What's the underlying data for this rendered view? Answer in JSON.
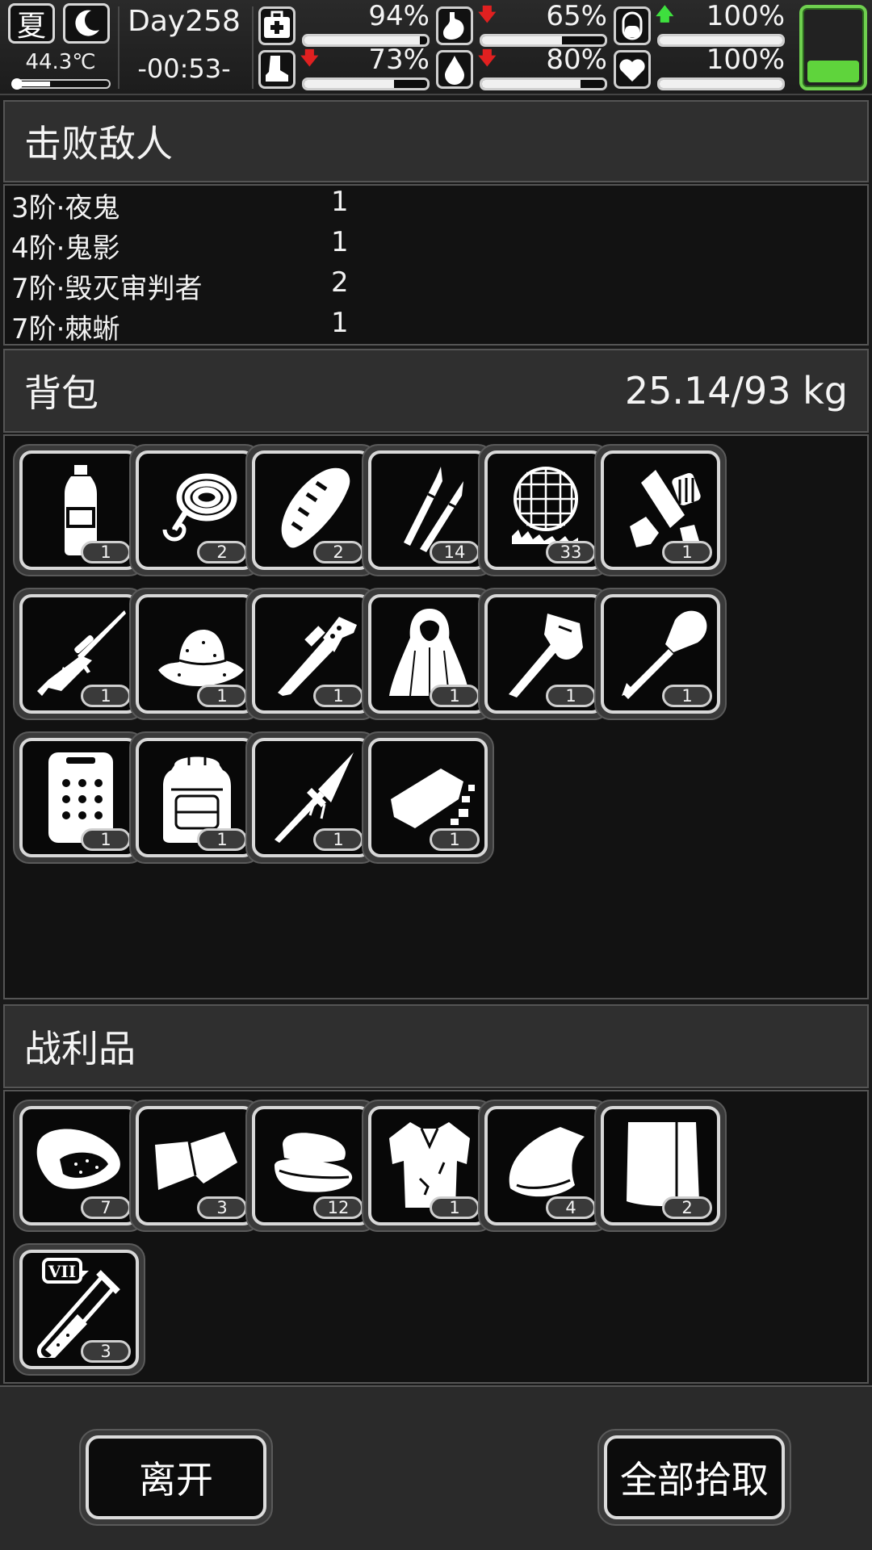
{
  "status": {
    "season": "夏",
    "temperature": "44.3℃",
    "day": "Day258",
    "time": "-00:53-",
    "battery_level": 0.28,
    "accent_green": "#5fd43c",
    "stats": [
      {
        "name": "health",
        "icon": "first-aid-icon",
        "value": "94%",
        "fill": 0.94,
        "arrow": ""
      },
      {
        "name": "hunger",
        "icon": "stomach-icon",
        "value": "65%",
        "fill": 0.65,
        "arrow": "down"
      },
      {
        "name": "mood",
        "icon": "capsule-icon",
        "value": "100%",
        "fill": 1.0,
        "arrow": "up"
      },
      {
        "name": "stamina",
        "icon": "boot-icon",
        "value": "73%",
        "fill": 0.73,
        "arrow": "down"
      },
      {
        "name": "thirst",
        "icon": "water-drop-icon",
        "value": "80%",
        "fill": 0.8,
        "arrow": "down"
      },
      {
        "name": "spirit",
        "icon": "heart-icon",
        "value": "100%",
        "fill": 1.0,
        "arrow": ""
      }
    ]
  },
  "defeated": {
    "title": "击败敌人",
    "enemies": [
      {
        "name": "3阶·夜鬼",
        "count": "1"
      },
      {
        "name": "4阶·鬼影",
        "count": "1"
      },
      {
        "name": "7阶·毁灭审判者",
        "count": "2"
      },
      {
        "name": "7阶·棘蜥",
        "count": "1"
      }
    ]
  },
  "backpack": {
    "title": "背包",
    "weight": "25.14/93 kg",
    "items": [
      {
        "icon": "water-bottle-icon",
        "count": "1"
      },
      {
        "icon": "rope-icon",
        "count": "2"
      },
      {
        "icon": "bread-icon",
        "count": "2"
      },
      {
        "icon": "bullets-icon",
        "count": "14"
      },
      {
        "icon": "net-icon",
        "count": "33"
      },
      {
        "icon": "bandage-icon",
        "count": "1"
      },
      {
        "icon": "sniper-rifle-icon",
        "count": "1"
      },
      {
        "icon": "bush-hat-icon",
        "count": "1"
      },
      {
        "icon": "machete-icon",
        "count": "1"
      },
      {
        "icon": "cloak-icon",
        "count": "1"
      },
      {
        "icon": "axe-icon",
        "count": "1"
      },
      {
        "icon": "shovel-icon",
        "count": "1"
      },
      {
        "icon": "armor-plate-icon",
        "count": "1"
      },
      {
        "icon": "backpack-icon",
        "count": "1"
      },
      {
        "icon": "spear-icon",
        "count": "1"
      },
      {
        "icon": "dried-meat-icon",
        "count": "1"
      }
    ]
  },
  "loot": {
    "title": "战利品",
    "items": [
      {
        "icon": "raw-meat-icon",
        "count": "7"
      },
      {
        "icon": "leather-icon",
        "count": "3"
      },
      {
        "icon": "cloth-stack-icon",
        "count": "12"
      },
      {
        "icon": "torn-shirt-icon",
        "count": "1"
      },
      {
        "icon": "hide-roll-icon",
        "count": "4"
      },
      {
        "icon": "fabric-sheet-icon",
        "count": "2"
      },
      {
        "icon": "serum-tube-icon",
        "count": "3",
        "tag": "VII"
      }
    ]
  },
  "footer": {
    "leave_label": "离开",
    "take_all_label": "全部拾取"
  }
}
